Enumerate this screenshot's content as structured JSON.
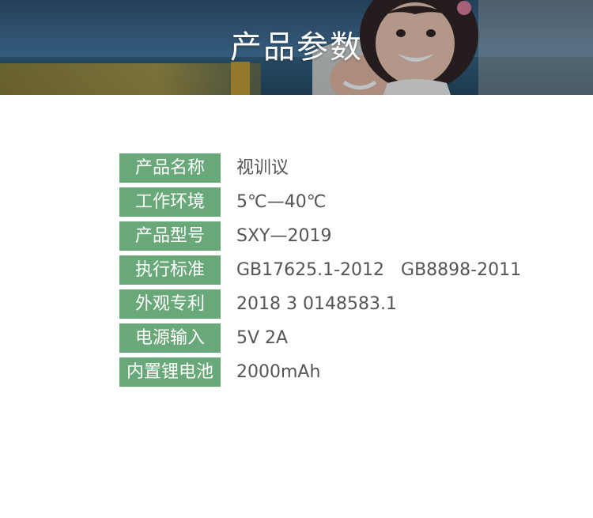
{
  "banner": {
    "title": "产品参数"
  },
  "specs": [
    {
      "label": "产品名称",
      "value": "视训议"
    },
    {
      "label": "工作环境",
      "value": "5℃—40℃"
    },
    {
      "label": "产品型号",
      "value": "SXY—2019"
    },
    {
      "label": "执行标准",
      "value": "GB17625.1-2012   GB8898-2011"
    },
    {
      "label": "外观专利",
      "value": "2018 3 0148583.1"
    },
    {
      "label": "电源输入",
      "value": "5V 2A"
    },
    {
      "label": "内置锂电池",
      "value": "2000mAh"
    }
  ],
  "colors": {
    "label_bg": "#69a878",
    "value_text": "#555555",
    "banner_text": "#ffffff"
  }
}
